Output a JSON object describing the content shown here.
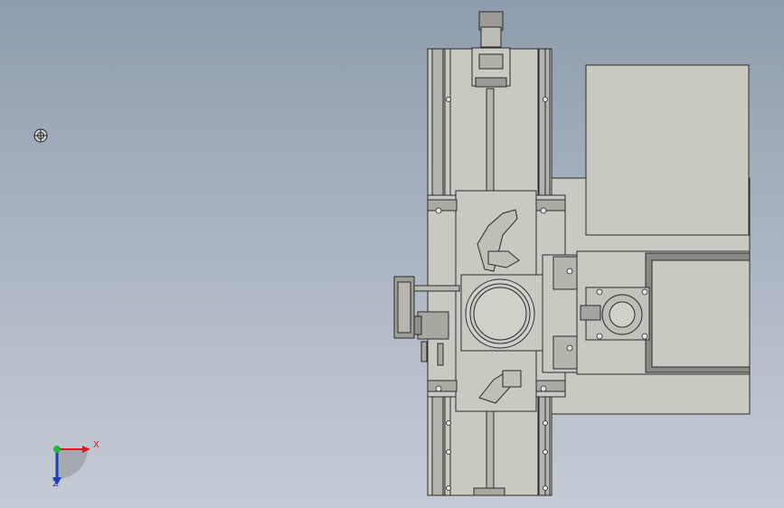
{
  "viewport": {
    "background_top": "#8e9cad",
    "background_bottom": "#c4cbd4"
  },
  "triad": {
    "x_label": "X",
    "z_label": "Z",
    "x_color": "#d81e1e",
    "y_color": "#22b83a",
    "z_color": "#1d3fb5"
  },
  "model": {
    "part_fill": "#c9c9c1",
    "part_stroke": "#2a2a2a",
    "slot_fill": "#9d9d96"
  }
}
